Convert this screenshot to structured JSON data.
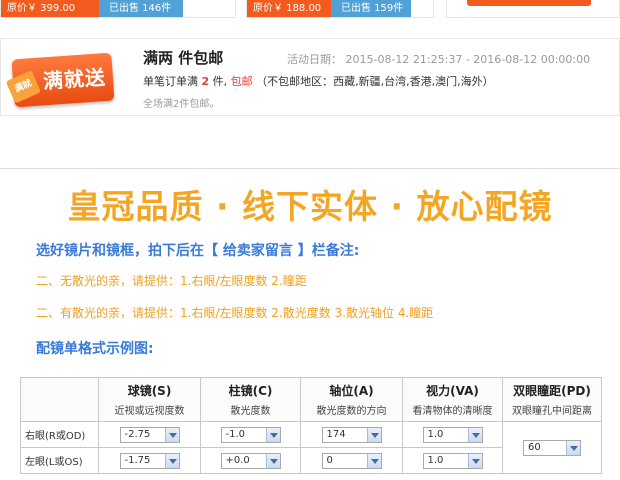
{
  "top_cards": [
    {
      "price": "原价￥ 399.00",
      "sold": "已出售 146件"
    },
    {
      "price": "原价￥ 188.00",
      "sold": "已出售 159件"
    }
  ],
  "promo": {
    "badge_sub": "满就",
    "badge_main": "满就送",
    "title": "满两 件包邮",
    "date_range": "活动日期： 2015-08-12 21:25:37 - 2016-08-12 00:00:00",
    "line_prefix": "单笔订单满 ",
    "line_num": "2",
    "line_mid": " 件, ",
    "line_red": "包邮",
    "line_suffix": " （不包邮地区：西藏,新疆,台湾,香港,澳门,海外）",
    "note": "全场满2件包邮。"
  },
  "headline": "皇冠品质 · 线下实体 · 放心配镜",
  "subhead": "选好镜片和镜框，拍下后在【 给卖家留言 】栏备注:",
  "tips": [
    "二、无散光的亲，请提供：1.右眼/左眼度数 2.瞳距",
    "二、有散光的亲，请提供：1.右眼/左眼度数 2.散光度数 3.散光轴位 4.瞳距"
  ],
  "example_title": "配镜单格式示例图:",
  "table": {
    "headers": [
      {
        "title": "",
        "desc": ""
      },
      {
        "title": "球镜(S)",
        "desc": "近视或远视度数"
      },
      {
        "title": "柱镜(C)",
        "desc": "散光度数"
      },
      {
        "title": "轴位(A)",
        "desc": "散光度数的方向"
      },
      {
        "title": "视力(VA)",
        "desc": "看清物体的清晰度"
      },
      {
        "title": "双眼瞳距(PD)",
        "desc": "双眼瞳孔中间距离"
      }
    ],
    "rows": [
      {
        "label": "右眼(R或OD)",
        "sphere": "-2.75",
        "cylinder": "-1.0",
        "axis": "174",
        "va": "1.0"
      },
      {
        "label": "左眼(L或OS)",
        "sphere": "-1.75",
        "cylinder": "+0.0",
        "axis": "0",
        "va": "1.0"
      }
    ],
    "pd": "60"
  }
}
